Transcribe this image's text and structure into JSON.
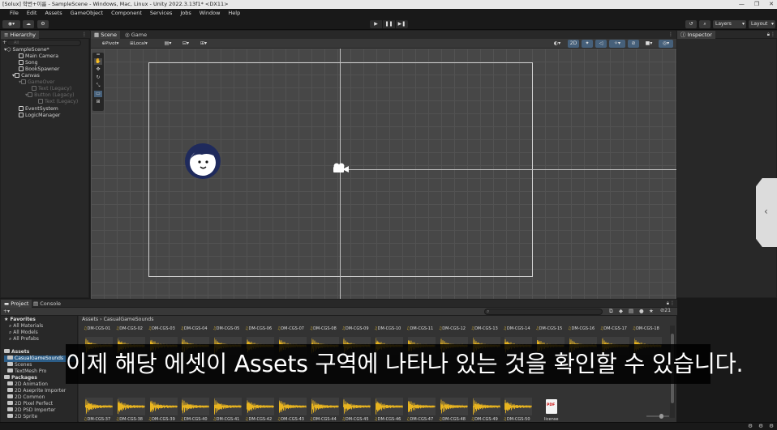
{
  "title_bar": {
    "text": "[Solux] 학번+이름 - SampleScene - Windows, Mac, Linux - Unity 2022.3.13f1* <DX11>",
    "minimize": "—",
    "maximize": "❐",
    "close": "✕"
  },
  "menu": [
    "File",
    "Edit",
    "Assets",
    "GameObject",
    "Component",
    "Services",
    "Jobs",
    "Window",
    "Help"
  ],
  "toolbar": {
    "layers_label": "Layers",
    "layout_label": "Layout"
  },
  "hierarchy": {
    "tab_label": "Hierarchy",
    "search_placeholder": "All",
    "items": [
      {
        "label": "SampleScene*",
        "dim": false
      },
      {
        "label": "Main Camera",
        "dim": false
      },
      {
        "label": "Song",
        "dim": false
      },
      {
        "label": "BookSpawner",
        "dim": false
      },
      {
        "label": "Canvas",
        "dim": false
      },
      {
        "label": "GameOver",
        "dim": true
      },
      {
        "label": "Text (Legacy)",
        "dim": true
      },
      {
        "label": "Button (Legacy)",
        "dim": true
      },
      {
        "label": "Text (Legacy)",
        "dim": true
      },
      {
        "label": "EventSystem",
        "dim": false
      },
      {
        "label": "LogicManager",
        "dim": false
      }
    ]
  },
  "scene": {
    "tab_scene": "Scene",
    "tab_game": "Game",
    "pivot_label": "Pivot",
    "local_label": "Local",
    "mode_2d_label": "2D"
  },
  "inspector": {
    "tab_label": "Inspector"
  },
  "project": {
    "tab_project": "Project",
    "tab_console": "Console",
    "hidden_count": "21",
    "favorites_label": "Favorites",
    "favorites": [
      "All Materials",
      "All Models",
      "All Prefabs"
    ],
    "assets_label": "Assets",
    "asset_folders": [
      "CasualGameSounds",
      "Scenes",
      "TextMesh Pro"
    ],
    "packages_label": "Packages",
    "packages": [
      "2D Animation",
      "2D Aseprite Importer",
      "2D Common",
      "2D Pixel Perfect",
      "2D PSD Importer",
      "2D Sprite"
    ],
    "breadcrumb_root": "Assets",
    "breadcrumb_folder": "CasualGameSounds",
    "row1_labels": [
      "DM-CGS-01",
      "DM-CGS-02",
      "DM-CGS-03",
      "DM-CGS-04",
      "DM-CGS-05",
      "DM-CGS-06",
      "DM-CGS-07",
      "DM-CGS-08",
      "DM-CGS-09",
      "DM-CGS-10",
      "DM-CGS-11",
      "DM-CGS-12",
      "DM-CGS-13",
      "DM-CGS-14",
      "DM-CGS-15",
      "DM-CGS-16",
      "DM-CGS-17",
      "DM-CGS-18"
    ],
    "row3_labels": [
      "DM-CGS-37",
      "DM-CGS-38",
      "DM-CGS-39",
      "DM-CGS-40",
      "DM-CGS-41",
      "DM-CGS-42",
      "DM-CGS-43",
      "DM-CGS-44",
      "DM-CGS-45",
      "DM-CGS-46",
      "DM-CGS-47",
      "DM-CGS-48",
      "DM-CGS-49",
      "DM-CGS-50"
    ],
    "pdf_label": "license",
    "pdf_badge": "PDF"
  },
  "subtitle": "이제 해당 에셋이 Assets 구역에 나타나 있는 것을 확인할 수 있습니다.",
  "colors": {
    "waveform": "#e8b420",
    "selection": "#2c5d87",
    "avatar_ring": "#1f2a5c"
  }
}
